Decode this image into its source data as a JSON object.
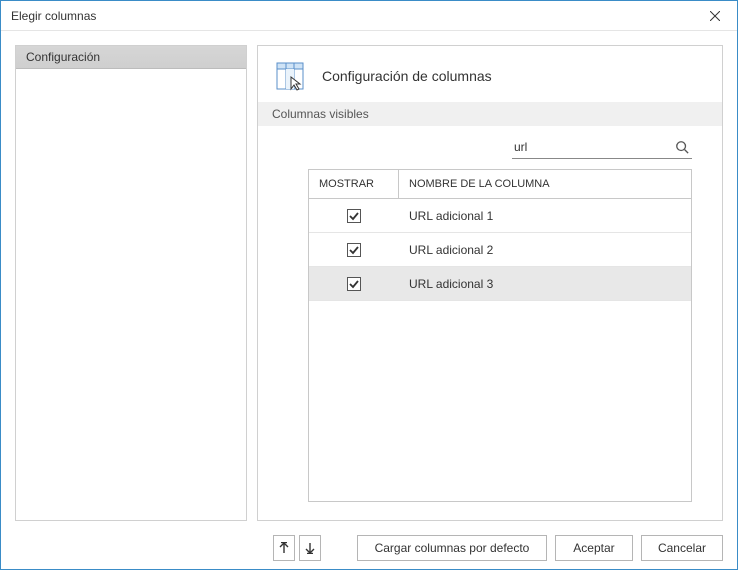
{
  "window": {
    "title": "Elegir columnas"
  },
  "sidebar": {
    "items": [
      "Configuración"
    ]
  },
  "main": {
    "title": "Configuración de columnas",
    "section_label": "Columnas visibles",
    "search_value": "url"
  },
  "table": {
    "headers": {
      "show": "MOSTRAR",
      "name": "NOMBRE DE LA COLUMNA"
    },
    "rows": [
      {
        "checked": true,
        "name": "URL adicional 1",
        "selected": false
      },
      {
        "checked": true,
        "name": "URL adicional 2",
        "selected": false
      },
      {
        "checked": true,
        "name": "URL adicional 3",
        "selected": true
      }
    ]
  },
  "footer": {
    "load_defaults": "Cargar columnas por defecto",
    "accept": "Aceptar",
    "cancel": "Cancelar"
  }
}
